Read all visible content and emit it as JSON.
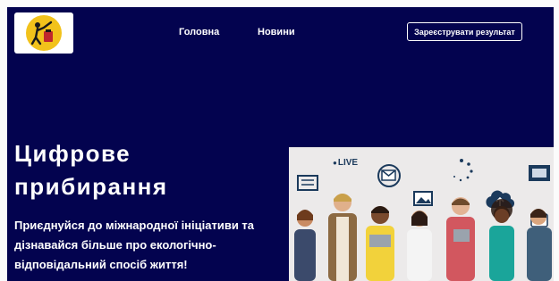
{
  "header": {
    "logo_icon": "cleaning-person-logo-icon",
    "nav": [
      {
        "label": "Головна"
      },
      {
        "label": "Новини"
      }
    ],
    "cta_label": "Зареєструвати результат"
  },
  "hero": {
    "title_line1": "Цифрове",
    "title_line2": "прибирання",
    "subtitle_line1": "Приєднуйся до міжнародної ініціативи та",
    "subtitle_line2": "дізнавайся більше про екологічно-",
    "subtitle_line3": "відповідальний спосіб життя!",
    "image": {
      "live_label": "LIVE",
      "icons": [
        "news-icon",
        "email-icon",
        "loading-icon",
        "film-icon",
        "photo-icon",
        "cloud-upload-icon",
        "video-icon"
      ]
    }
  },
  "colors": {
    "background": "#03034f",
    "logo_circle": "#f2c21b",
    "text": "#ffffff"
  }
}
